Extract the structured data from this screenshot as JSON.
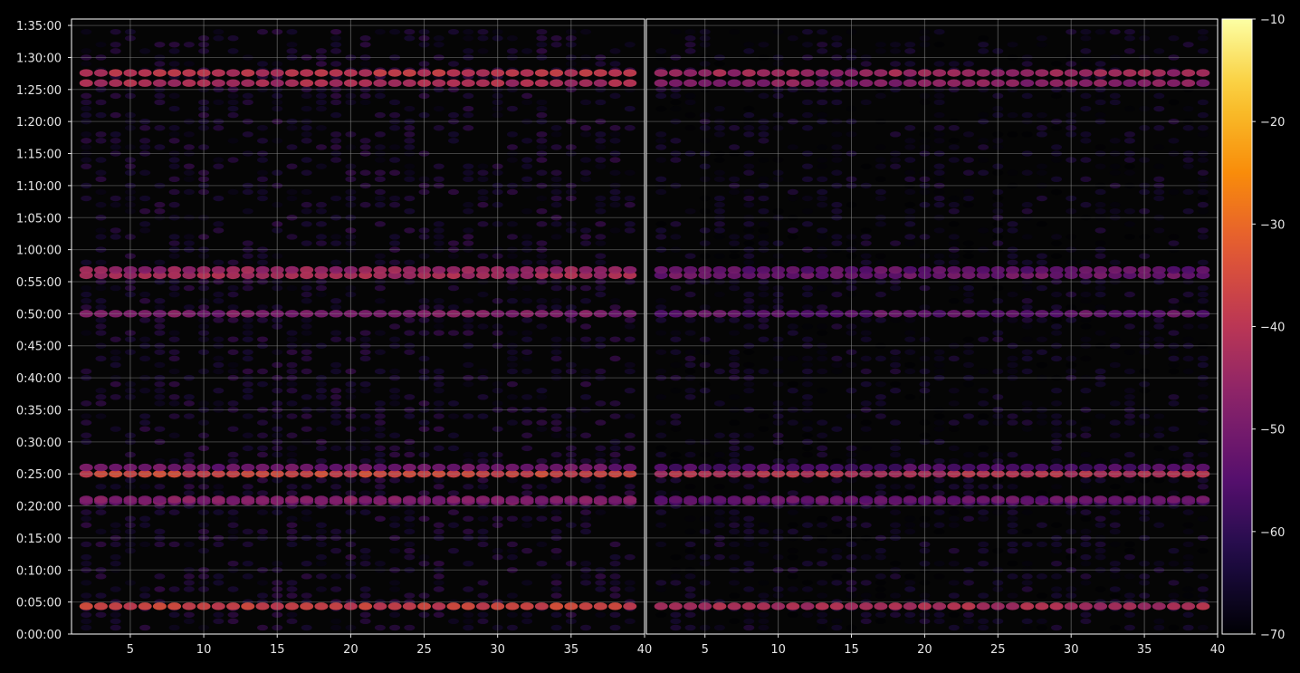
{
  "chart_data": {
    "type": "heatmap",
    "background": "#050505",
    "frame_color": "#ffffff",
    "grid_color": "#8a8a8a",
    "grid": true,
    "panels": [
      {
        "id": "left",
        "x_ticks": [
          "5",
          "10",
          "15",
          "20",
          "25",
          "30",
          "35",
          "40"
        ],
        "x_tick_values": [
          5,
          10,
          15,
          20,
          25,
          30,
          35,
          40
        ],
        "xlim": [
          1,
          40
        ]
      },
      {
        "id": "right",
        "x_ticks": [
          "5",
          "10",
          "15",
          "20",
          "25",
          "30",
          "35",
          "40"
        ],
        "x_tick_values": [
          5,
          10,
          15,
          20,
          25,
          30,
          35,
          40
        ],
        "xlim": [
          1,
          40
        ]
      }
    ],
    "y_ticks": [
      "0:00:00",
      "0:05:00",
      "0:10:00",
      "0:15:00",
      "0:20:00",
      "0:25:00",
      "0:30:00",
      "0:35:00",
      "0:40:00",
      "0:45:00",
      "0:50:00",
      "0:55:00",
      "1:00:00",
      "1:05:00",
      "1:10:00",
      "1:15:00",
      "1:20:00",
      "1:25:00",
      "1:30:00",
      "1:35:00"
    ],
    "y_tick_seconds": [
      0,
      300,
      600,
      900,
      1200,
      1500,
      1800,
      2100,
      2400,
      2700,
      3000,
      3300,
      3600,
      3900,
      4200,
      4500,
      4800,
      5100,
      5400,
      5700
    ],
    "ylim_seconds": [
      0,
      5760
    ],
    "colorbar": {
      "colormap": "inferno",
      "range": [
        -70,
        -10
      ],
      "ticks": [
        "−70",
        "−60",
        "−50",
        "−40",
        "−30",
        "−20",
        "−10"
      ],
      "tick_values": [
        -70,
        -60,
        -50,
        -40,
        -30,
        -20,
        -10
      ],
      "position": "right"
    },
    "bands": [
      {
        "time_s": 260,
        "level_left": -37,
        "level_right": -42
      },
      {
        "time_s": 1240,
        "level_left": -50,
        "level_right": -55
      },
      {
        "time_s": 1260,
        "level_left": -48,
        "level_right": -52
      },
      {
        "time_s": 1500,
        "level_left": -36,
        "level_right": -41
      },
      {
        "time_s": 1560,
        "level_left": -51,
        "level_right": -56
      },
      {
        "time_s": 3000,
        "level_left": -49,
        "level_right": -53
      },
      {
        "time_s": 3360,
        "level_left": -43,
        "level_right": -51
      },
      {
        "time_s": 3410,
        "level_left": -45,
        "level_right": -53
      },
      {
        "time_s": 5160,
        "level_left": -42,
        "level_right": -47
      },
      {
        "time_s": 5255,
        "level_left": -40,
        "level_right": -44
      }
    ]
  }
}
